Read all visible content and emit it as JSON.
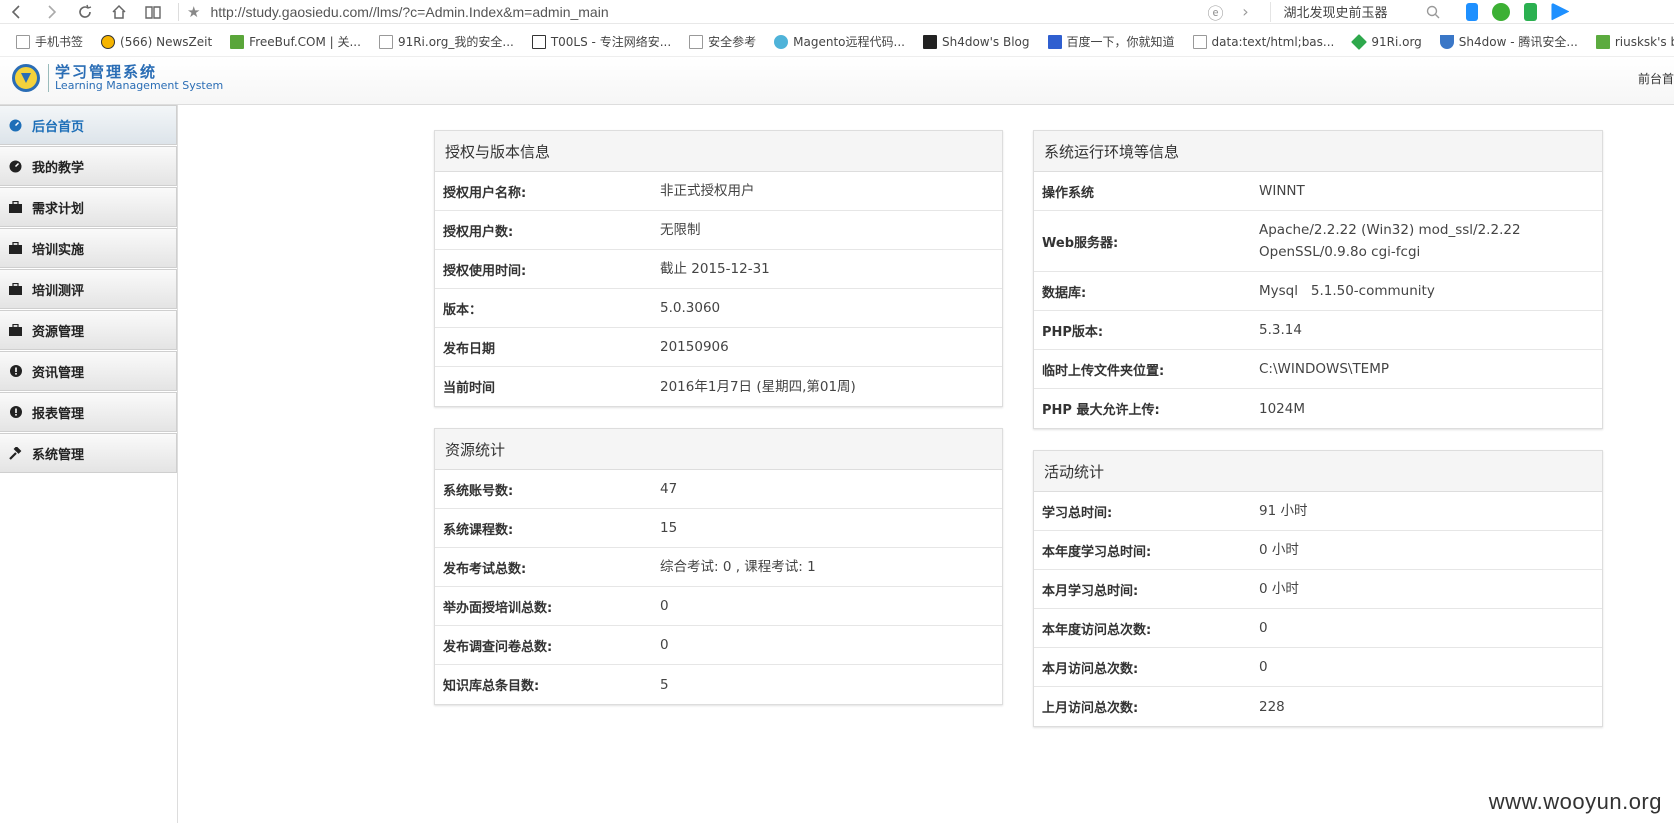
{
  "browser": {
    "url": "http://study.gaosiedu.com//lms/?c=Admin.Index&m=admin_main",
    "search_text": "湖北发现史前玉器"
  },
  "bookmarks": [
    "手机书签",
    "(566) NewsZeit",
    "FreeBuf.COM | 关...",
    "91Ri.org_我的安全...",
    "T00LS - 专注网络安...",
    "安全参考",
    "Magento远程代码...",
    "Sh4dow's Blog",
    "百度一下，你就知道",
    "data:text/html;bas...",
    "91Ri.org",
    "Sh4dow - 腾讯安全...",
    "riusksk's b"
  ],
  "header": {
    "logo_cn": "学习管理系统",
    "logo_en": "Learning Management System",
    "right_link": "前台首"
  },
  "sidebar": {
    "items": [
      {
        "label": "后台首页",
        "icon": "dashboard-icon"
      },
      {
        "label": "我的教学",
        "icon": "dashboard-icon"
      },
      {
        "label": "需求计划",
        "icon": "briefcase-icon"
      },
      {
        "label": "培训实施",
        "icon": "briefcase-icon"
      },
      {
        "label": "培训测评",
        "icon": "briefcase-icon"
      },
      {
        "label": "资源管理",
        "icon": "briefcase-icon"
      },
      {
        "label": "资讯管理",
        "icon": "info-icon"
      },
      {
        "label": "报表管理",
        "icon": "info-icon"
      },
      {
        "label": "系统管理",
        "icon": "hammer-icon"
      }
    ]
  },
  "panels": {
    "license": {
      "title": "授权与版本信息",
      "rows": [
        {
          "k": "授权用户名称:",
          "v": "非正式授权用户"
        },
        {
          "k": "授权用户数:",
          "v": "无限制"
        },
        {
          "k": "授权使用时间:",
          "v": "截止 2015-12-31"
        },
        {
          "k": "版本：",
          "v": "5.0.3060"
        },
        {
          "k": "发布日期",
          "v": "20150906"
        },
        {
          "k": "当前时间",
          "v": "2016年1月7日 (星期四,第01周)"
        }
      ]
    },
    "resources": {
      "title": "资源统计",
      "rows": [
        {
          "k": "系统账号数:",
          "v": "47"
        },
        {
          "k": "系统课程数:",
          "v": "15"
        },
        {
          "k": "发布考试总数:",
          "v": "综合考试: 0 , 课程考试: 1"
        },
        {
          "k": "举办面授培训总数:",
          "v": "0"
        },
        {
          "k": "发布调查问卷总数:",
          "v": "0"
        },
        {
          "k": "知识库总条目数:",
          "v": "5"
        }
      ]
    },
    "environment": {
      "title": "系统运行环境等信息",
      "rows": [
        {
          "k": "操作系统",
          "v": "WINNT"
        },
        {
          "k": "Web服务器:",
          "v": "Apache/2.2.22 (Win32) mod_ssl/2.2.22 OpenSSL/0.9.8o cgi-fcgi"
        },
        {
          "k": "数据库:",
          "v": "Mysql   5.1.50-community"
        },
        {
          "k": "PHP版本:",
          "v": "5.3.14"
        },
        {
          "k": "临时上传文件夹位置:",
          "v": "C:\\WINDOWS\\TEMP"
        },
        {
          "k": "PHP 最大允许上传:",
          "v": "1024M"
        }
      ]
    },
    "activity": {
      "title": "活动统计",
      "rows": [
        {
          "k": "学习总时间:",
          "v": "91 小时"
        },
        {
          "k": "本年度学习总时间:",
          "v": "0 小时"
        },
        {
          "k": "本月学习总时间:",
          "v": "0 小时"
        },
        {
          "k": "本年度访问总次数:",
          "v": "0"
        },
        {
          "k": "本月访问总次数:",
          "v": "0"
        },
        {
          "k": "上月访问总次数:",
          "v": "228"
        }
      ]
    }
  },
  "watermark": "www.wooyun.org"
}
